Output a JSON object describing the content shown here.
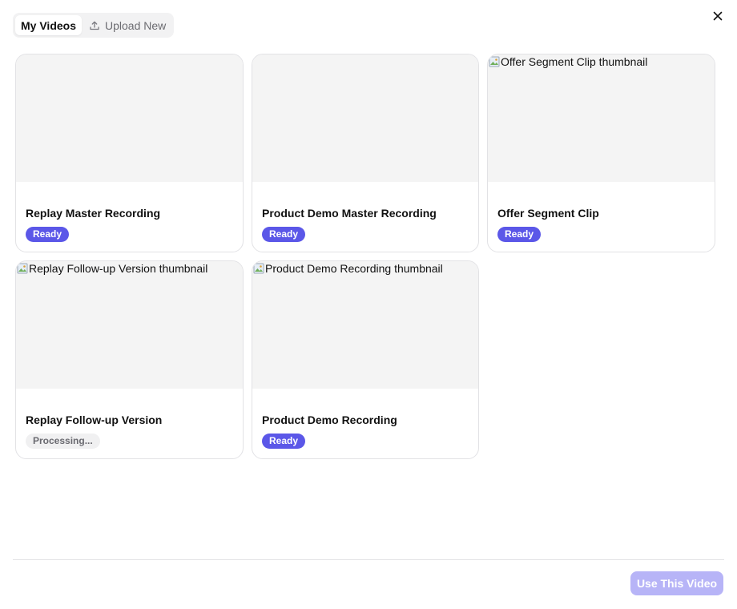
{
  "tabs": [
    {
      "label": "My Videos",
      "active": true
    },
    {
      "label": "Upload New",
      "active": false,
      "icon": "upload-icon"
    }
  ],
  "close_icon": "close-icon",
  "videos": [
    {
      "title": "Replay Master Recording",
      "status": "Ready",
      "thumbnail_alt": ""
    },
    {
      "title": "Product Demo Master Recording",
      "status": "Ready",
      "thumbnail_alt": ""
    },
    {
      "title": "Offer Segment Clip",
      "status": "Ready",
      "thumbnail_alt": "Offer Segment Clip thumbnail"
    },
    {
      "title": "Replay Follow-up Version",
      "status": "Processing...",
      "thumbnail_alt": "Replay Follow-up Version thumbnail"
    },
    {
      "title": "Product Demo Recording",
      "status": "Ready",
      "thumbnail_alt": "Product Demo Recording thumbnail"
    }
  ],
  "footer": {
    "use_button_label": "Use This Video",
    "use_button_enabled": false
  },
  "colors": {
    "accent": "#5b57e8",
    "accent_disabled": "#b7b4f7",
    "processing_bg": "#f0f0f1"
  }
}
